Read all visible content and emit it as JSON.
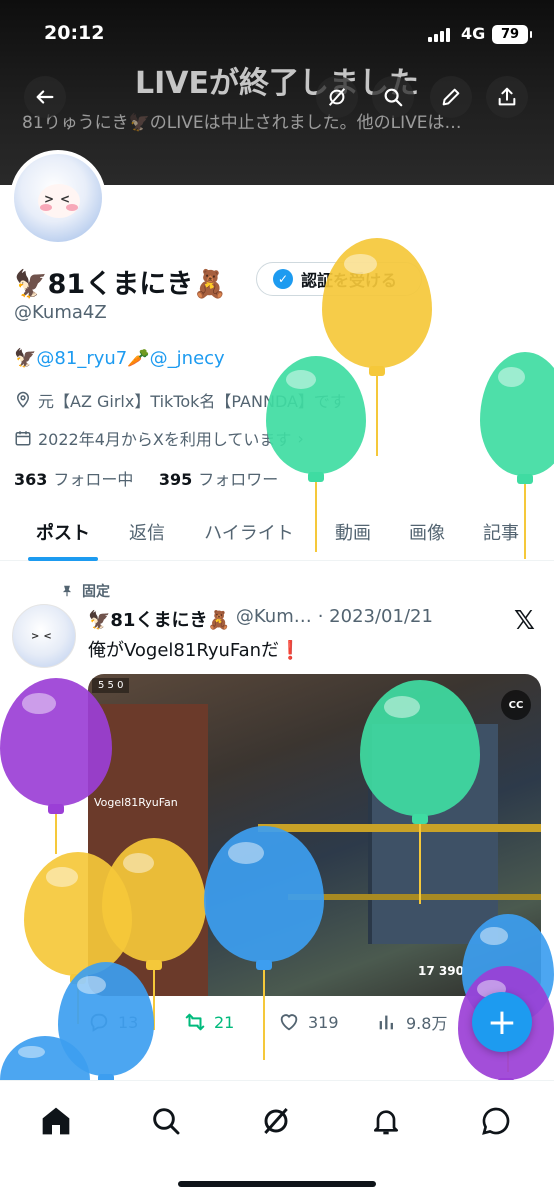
{
  "status_bar": {
    "time": "20:12",
    "network": "4G",
    "battery": "79"
  },
  "live_banner": {
    "title": "LIVEが終了しました",
    "subtitle": "81りゅうにき🦅のLIVEは中止されました。他のLIVEは…"
  },
  "header_buttons": [
    "back-icon",
    "grok-icon",
    "search-icon",
    "edit-icon",
    "share-icon"
  ],
  "profile": {
    "display_name": "🦅81くまにき🧸",
    "handle": "@Kuma4Z",
    "verify_label": "認証を受ける",
    "bio": {
      "prefix": "🦅",
      "mention1": "@81_ryu7",
      "carrot": "🥕",
      "mention2": "@_jnecy"
    },
    "location": "元【AZ Girlx】TikTok名【PANNDA】です",
    "joined": "2022年4月からXを利用しています",
    "following_count": "363",
    "following_label": "フォロー中",
    "followers_count": "395",
    "followers_label": "フォロワー"
  },
  "tabs": [
    {
      "label": "ポスト",
      "active": true
    },
    {
      "label": "返信",
      "active": false
    },
    {
      "label": "ハイライト",
      "active": false
    },
    {
      "label": "動画",
      "active": false
    },
    {
      "label": "画像",
      "active": false
    },
    {
      "label": "記事",
      "active": false
    }
  ],
  "pinned_post": {
    "pinned_label": "固定",
    "author_name": "🦅81くまにき🧸",
    "author_handle": "@Kum…",
    "date": "· 2023/01/21",
    "text": "俺がVogel81RyuFanだ",
    "text_mark": "❗",
    "video": {
      "hud": "5 5 0",
      "player_tag": "Vogel81RyuFan",
      "ammo": "17 390",
      "cc_label": "CC"
    },
    "replies": "13",
    "reposts": "21",
    "likes": "319",
    "views": "9.8万"
  },
  "fab_label": "+",
  "bottom_nav": [
    "home-icon",
    "explore-icon",
    "grok-icon",
    "notifications-icon",
    "messages-icon"
  ],
  "balloon_colors": {
    "yellow": "#f5c83a",
    "teal": "#3fdca2",
    "purple": "#9b3fd6",
    "blue": "#3d9ef0",
    "accent": "#1d9bf0"
  }
}
